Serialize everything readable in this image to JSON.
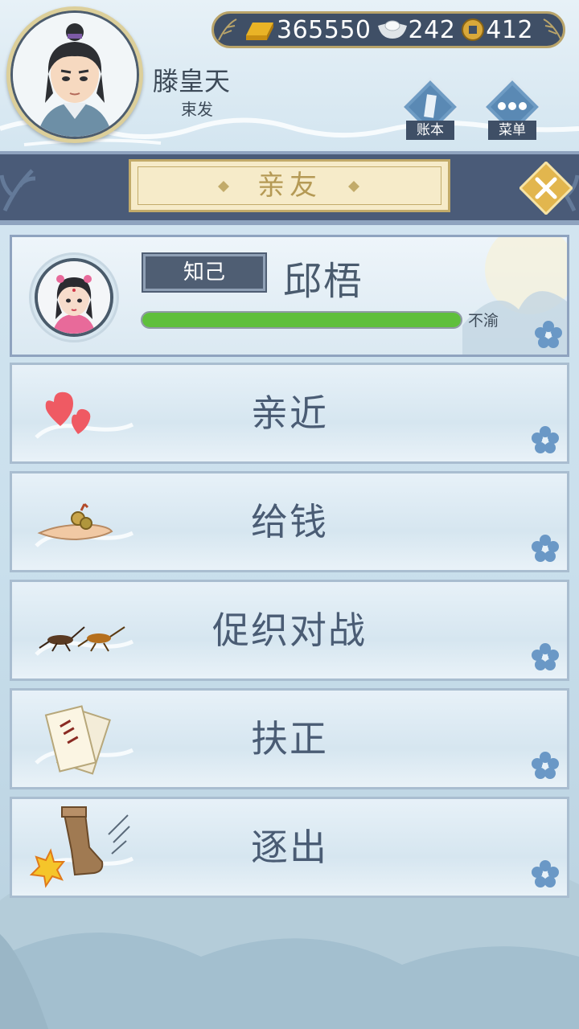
{
  "player": {
    "name": "滕皇天",
    "title": "束发",
    "avatar_icon": "male-scholar-avatar"
  },
  "currencies": [
    {
      "icon": "gold-bar-icon",
      "value": "365550"
    },
    {
      "icon": "silver-ingot-icon",
      "value": "242"
    },
    {
      "icon": "copper-coin-icon",
      "value": "412"
    }
  ],
  "header_buttons": {
    "ledger": {
      "label": "账本",
      "icon": "ledger-icon"
    },
    "menu": {
      "label": "菜单",
      "icon": "more-dots-icon"
    }
  },
  "page": {
    "title": "亲友",
    "close_icon": "close-icon"
  },
  "friend": {
    "name": "邱梧",
    "relation": "知己",
    "mood_label": "不渝",
    "mood_progress": 1.0,
    "avatar_icon": "female-avatar"
  },
  "actions": [
    {
      "label": "亲近",
      "icon": "hearts-icon"
    },
    {
      "label": "给钱",
      "icon": "hand-coins-icon"
    },
    {
      "label": "促织对战",
      "icon": "crickets-icon"
    },
    {
      "label": "扶正",
      "icon": "document-icon"
    },
    {
      "label": "逐出",
      "icon": "boot-kick-icon"
    }
  ],
  "colors": {
    "accent_navy": "#4a5b78",
    "gold_trim": "#c2ab6a",
    "progress_green": "#5fbf3c",
    "text_dark": "#4a5c74"
  }
}
